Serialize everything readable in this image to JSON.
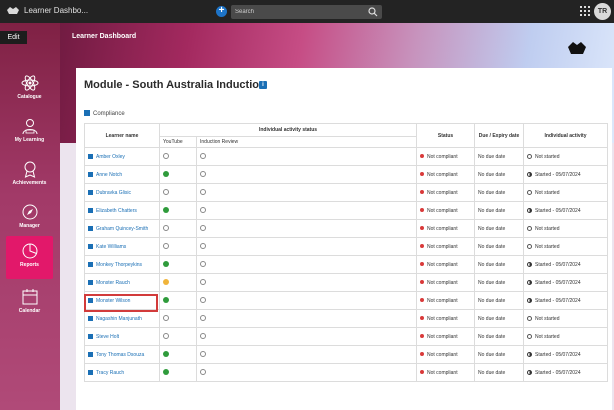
{
  "topbar": {
    "app_title": "Learner Dashbo...",
    "search_placeholder": "Search",
    "avatar_initials": "TR"
  },
  "hero": {
    "edit_label": "Edit",
    "title": "Learner Dashboard"
  },
  "sidebar": {
    "items": [
      {
        "label": "Catalogue",
        "icon": "atom-icon",
        "active": false
      },
      {
        "label": "My Learning",
        "icon": "person-learning-icon",
        "active": false
      },
      {
        "label": "Achievements",
        "icon": "badge-icon",
        "active": false
      },
      {
        "label": "Manager",
        "icon": "compass-icon",
        "active": false
      },
      {
        "label": "Reports",
        "icon": "pie-chart-icon",
        "active": true
      },
      {
        "label": "Calendar",
        "icon": "calendar-icon",
        "active": false
      }
    ]
  },
  "module": {
    "title": "Module - South Australia Induction",
    "compliance_label": "Compliance"
  },
  "table": {
    "headers": {
      "learner": "Learner name",
      "activity_status": "Individual activity status",
      "status": "Status",
      "due": "Due / Expiry date",
      "individual": "Individual activity"
    },
    "subheaders": {
      "youtube": "YouTube",
      "induction": "Induction Review"
    },
    "rows": [
      {
        "name": "Amber Oxley",
        "youtube": "none",
        "induction": "none",
        "status": "Not compliant",
        "due": "No due date",
        "activity": "Not started",
        "started": false
      },
      {
        "name": "Anne Notch",
        "youtube": "complete",
        "induction": "none",
        "status": "Not compliant",
        "due": "No due date",
        "activity": "Started - 05/07/2024",
        "started": true
      },
      {
        "name": "Dubravka Glisic",
        "youtube": "none",
        "induction": "none",
        "status": "Not compliant",
        "due": "No due date",
        "activity": "Not started",
        "started": false
      },
      {
        "name": "Elizabeth Chatters",
        "youtube": "complete",
        "induction": "none",
        "status": "Not compliant",
        "due": "No due date",
        "activity": "Started - 05/07/2024",
        "started": true
      },
      {
        "name": "Graham Quincey-Smith",
        "youtube": "none",
        "induction": "none",
        "status": "Not compliant",
        "due": "No due date",
        "activity": "Not started",
        "started": false
      },
      {
        "name": "Kate Williams",
        "youtube": "none",
        "induction": "none",
        "status": "Not compliant",
        "due": "No due date",
        "activity": "Not started",
        "started": false
      },
      {
        "name": "Monkey Thorpeykins",
        "youtube": "complete",
        "induction": "none",
        "status": "Not compliant",
        "due": "No due date",
        "activity": "Started - 05/07/2024",
        "started": true
      },
      {
        "name": "Monster Rauch",
        "youtube": "partial",
        "induction": "none",
        "status": "Not compliant",
        "due": "No due date",
        "activity": "Started - 05/07/2024",
        "started": true
      },
      {
        "name": "Monster Wilson",
        "youtube": "complete",
        "induction": "none",
        "status": "Not compliant",
        "due": "No due date",
        "activity": "Started - 05/07/2024",
        "started": true
      },
      {
        "name": "Nagashin Manjunath",
        "youtube": "none",
        "induction": "none",
        "status": "Not compliant",
        "due": "No due date",
        "activity": "Not started",
        "started": false
      },
      {
        "name": "Steve Holt",
        "youtube": "none",
        "induction": "none",
        "status": "Not compliant",
        "due": "No due date",
        "activity": "Not started",
        "started": false
      },
      {
        "name": "Tony Thomas Dsouza",
        "youtube": "complete",
        "induction": "none",
        "status": "Not compliant",
        "due": "No due date",
        "activity": "Started - 05/07/2024",
        "started": true
      },
      {
        "name": "Tracy Rauch",
        "youtube": "complete",
        "induction": "none",
        "status": "Not compliant",
        "due": "No due date",
        "activity": "Started - 05/07/2024",
        "started": true
      }
    ]
  },
  "colors": {
    "accent": "#e2186a",
    "link": "#1a6fb5",
    "complete": "#2f9b3b",
    "partial": "#f0b43a",
    "not_compliant": "#d93a3a",
    "highlight_border": "#d23b3b"
  }
}
